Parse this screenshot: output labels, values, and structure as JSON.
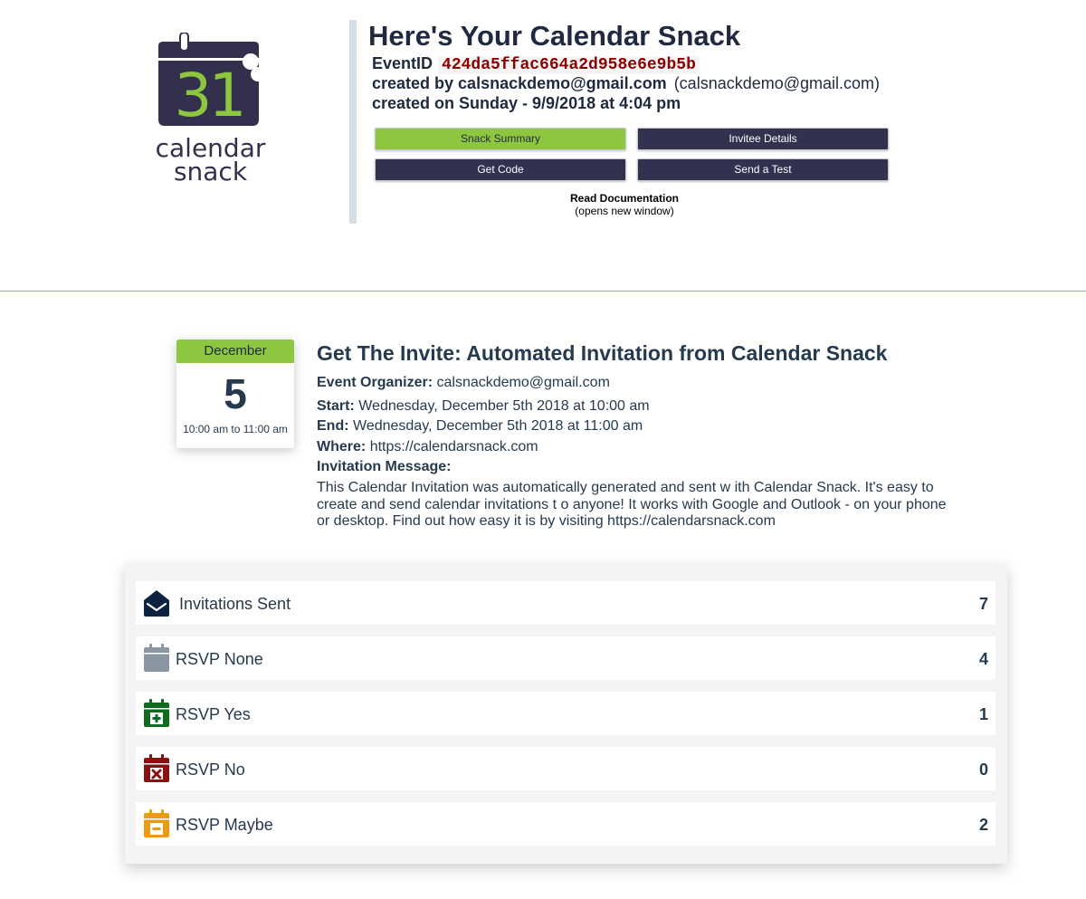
{
  "header": {
    "logo": {
      "number": "31",
      "word1": "calendar",
      "word2": "snack"
    },
    "title": "Here's Your Calendar Snack",
    "event_id_label": "EventID",
    "event_id": "424da5ffac664a2d958e6e9b5b",
    "created_by_label": "created by calsnackdemo@gmail.com",
    "created_by_email": "(calsnackdemo@gmail.com)",
    "created_on": "created on Sunday - 9/9/2018 at 4:04 pm",
    "buttons": {
      "snack_summary": "Snack Summary",
      "invitee_details": "Invitee Details",
      "get_code": "Get Code",
      "send_test": "Send a Test"
    },
    "docs_link": "Read Documentation",
    "docs_note": "(opens new window)"
  },
  "colors": {
    "brand_green": "#8dc63f",
    "brand_navy": "#333150"
  },
  "event": {
    "month": "December",
    "day": "5",
    "time_range": "10:00 am to 11:00 am",
    "title": "Get The Invite: Automated Invitation from Calendar Snack",
    "organizer_label": "Event Organizer:",
    "organizer": "calsnackdemo@gmail.com",
    "start_label": "Start:",
    "start": "Wednesday, December 5th 2018 at 10:00 am",
    "end_label": "End:",
    "end": "Wednesday, December 5th 2018 at 11:00 am",
    "where_label": "Where:",
    "where": "https://calendarsnack.com",
    "message_label": "Invitation Message:",
    "message": "This Calendar Invitation was automatically generated and sent w ith Calendar Snack. It's easy to create and send calendar invitations t o anyone! It works with Google and Outlook - on your phone or desktop. Find out how easy it is by visiting https://calendarsnack.com"
  },
  "stats": [
    {
      "label": "Invitations Sent",
      "count": "7",
      "icon": "envelope-open-icon",
      "color": "#0c2340"
    },
    {
      "label": "RSVP None",
      "count": "4",
      "icon": "calendar-icon",
      "color": "#8a96a3"
    },
    {
      "label": "RSVP Yes",
      "count": "1",
      "icon": "calendar-plus-icon",
      "color": "#0f6b1f"
    },
    {
      "label": "RSVP No",
      "count": "0",
      "icon": "calendar-times-icon",
      "color": "#8b1010"
    },
    {
      "label": "RSVP Maybe",
      "count": "2",
      "icon": "calendar-minus-icon",
      "color": "#eb9b12"
    }
  ]
}
